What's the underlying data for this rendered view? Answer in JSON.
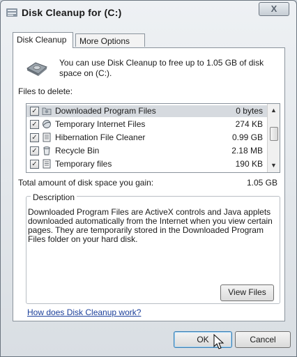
{
  "window": {
    "title": "Disk Cleanup for  (C:)",
    "close_label": "X"
  },
  "tabs": [
    {
      "label": "Disk Cleanup",
      "active": true
    },
    {
      "label": "More Options",
      "active": false
    }
  ],
  "intro_text": "You can use Disk Cleanup to free up to 1.05 GB of disk space on  (C:).",
  "files_to_delete_label": "Files to delete:",
  "files": [
    {
      "name": "Downloaded Program Files",
      "size": "0 bytes",
      "checked": true,
      "icon": "folder-icon",
      "selected": true
    },
    {
      "name": "Temporary Internet Files",
      "size": "274 KB",
      "checked": true,
      "icon": "internet-files-icon"
    },
    {
      "name": "Hibernation File Cleaner",
      "size": "0.99 GB",
      "checked": true,
      "icon": "document-icon"
    },
    {
      "name": "Recycle Bin",
      "size": "2.18 MB",
      "checked": true,
      "icon": "recycle-bin-icon"
    },
    {
      "name": "Temporary files",
      "size": "190 KB",
      "checked": true,
      "icon": "document-icon"
    }
  ],
  "total": {
    "label": "Total amount of disk space you gain:",
    "value": "1.05 GB"
  },
  "description": {
    "legend": "Description",
    "text": "Downloaded Program Files are ActiveX controls and Java applets downloaded automatically from the Internet when you view certain pages. They are temporarily stored in the Downloaded Program Files folder on your hard disk.",
    "view_files_label": "View Files"
  },
  "help_link": "How does Disk Cleanup work?",
  "buttons": {
    "ok": "OK",
    "cancel": "Cancel"
  },
  "colors": {
    "link": "#1b3f9a",
    "selection": "#d6dadf",
    "default_button_border": "#3c7fb1"
  }
}
